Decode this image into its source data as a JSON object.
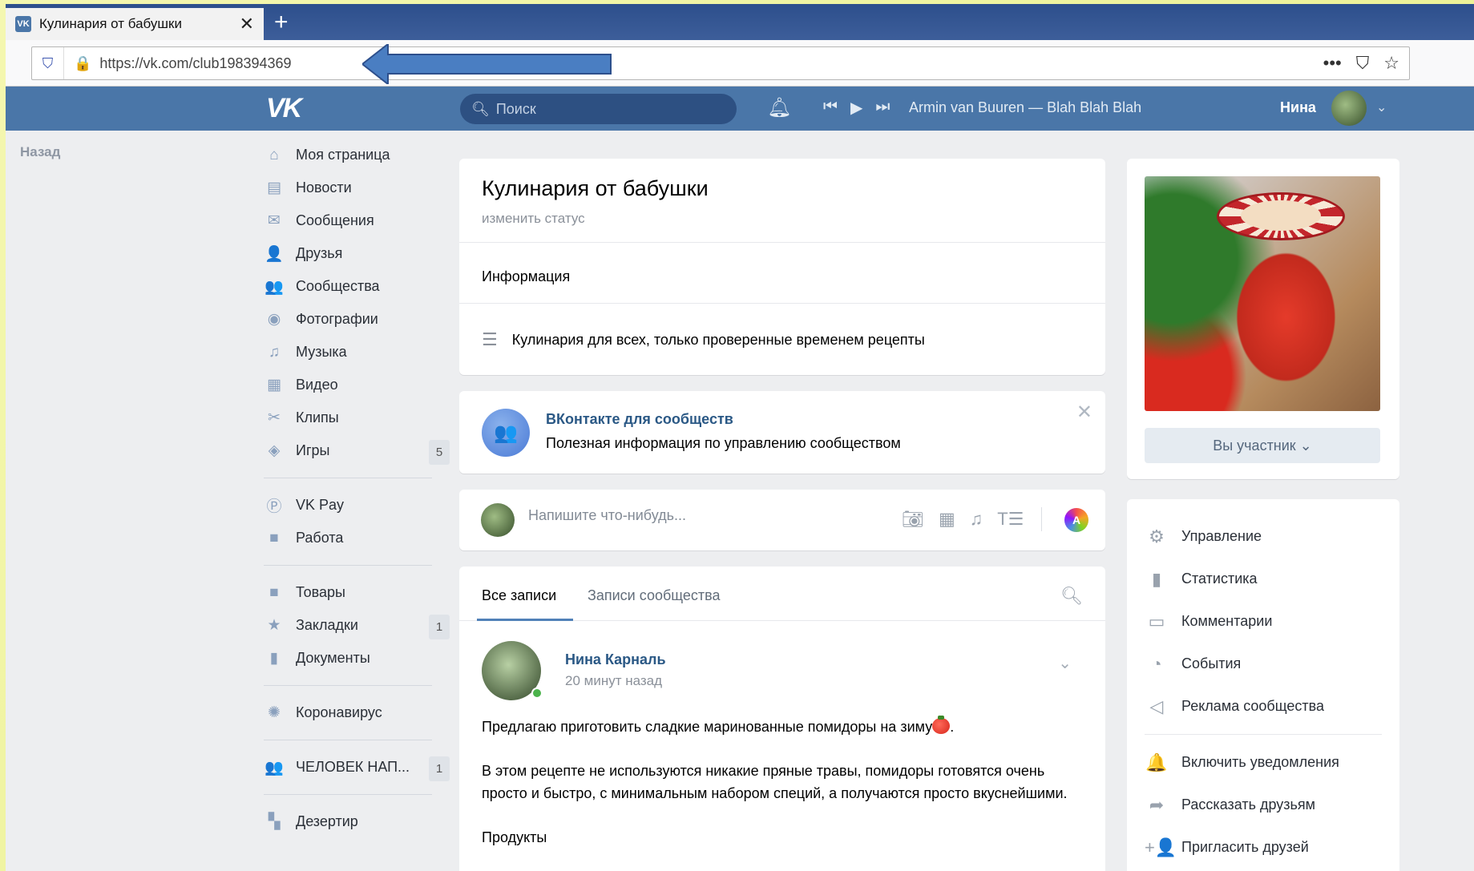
{
  "browser": {
    "tab_title": "Кулинария от бабушки",
    "tab_favicon": "VK",
    "new_tab": "+",
    "close": "✕",
    "url": "https://vk.com/club198394369",
    "menu": "•••"
  },
  "header": {
    "logo": "VK",
    "search_placeholder": "Поиск",
    "track": "Armin van Buuren — Blah Blah Blah",
    "user_name": "Нина"
  },
  "back": "Назад",
  "left_nav": {
    "group1": [
      {
        "label": "Моя страница",
        "icon": "home-icon",
        "glyph": "⌂"
      },
      {
        "label": "Новости",
        "icon": "news-icon",
        "glyph": "▤"
      },
      {
        "label": "Сообщения",
        "icon": "messages-icon",
        "glyph": "✉"
      },
      {
        "label": "Друзья",
        "icon": "friends-icon",
        "glyph": "👤"
      },
      {
        "label": "Сообщества",
        "icon": "communities-icon",
        "glyph": "👥"
      },
      {
        "label": "Фотографии",
        "icon": "camera-icon",
        "glyph": "◉"
      },
      {
        "label": "Музыка",
        "icon": "music-icon",
        "glyph": "♫"
      },
      {
        "label": "Видео",
        "icon": "video-icon",
        "glyph": "▦"
      },
      {
        "label": "Клипы",
        "icon": "clips-icon",
        "glyph": "✂"
      },
      {
        "label": "Игры",
        "icon": "games-icon",
        "glyph": "◈",
        "badge": "5"
      }
    ],
    "group2": [
      {
        "label": "VK Pay",
        "icon": "vkpay-icon",
        "glyph": "Ⓟ"
      },
      {
        "label": "Работа",
        "icon": "work-icon",
        "glyph": "■"
      }
    ],
    "group3": [
      {
        "label": "Товары",
        "icon": "goods-icon",
        "glyph": "■"
      },
      {
        "label": "Закладки",
        "icon": "star-icon",
        "glyph": "★",
        "badge": "1"
      },
      {
        "label": "Документы",
        "icon": "document-icon",
        "glyph": "▮"
      }
    ],
    "group4": [
      {
        "label": "Коронавирус",
        "icon": "virus-icon",
        "glyph": "✺"
      }
    ],
    "group5": [
      {
        "label": "ЧЕЛОВЕК НАП...",
        "icon": "group-icon",
        "glyph": "👥",
        "badge": "1"
      }
    ],
    "group6": [
      {
        "label": "Дезертир",
        "icon": "apps-icon",
        "glyph": "▚"
      }
    ]
  },
  "group": {
    "title": "Кулинария от бабушки",
    "status": "изменить статус",
    "info_title": "Информация",
    "description": "Кулинария для всех, только проверенные временем рецепты"
  },
  "promo": {
    "title": "ВКонтакте для сообществ",
    "text": "Полезная информация по управлению сообществом"
  },
  "compose": {
    "placeholder": "Напишите что-нибудь...",
    "color_label": "A"
  },
  "feed": {
    "tab_all": "Все записи",
    "tab_community": "Записи сообщества",
    "post": {
      "author": "Нина Карналь",
      "time": "20 минут назад",
      "p1": "Предлагаю приготовить сладкие маринованные помидоры на зиму",
      "p1_end": ".",
      "p2": "В этом рецепте не используются никакие пряные травы, помидоры готовятся очень просто и быстро, с минимальным набором специй, а получаются просто вкуснейшими.",
      "p3": "Продукты"
    }
  },
  "sidebar": {
    "member_button": "Вы участник ⌄",
    "menu": [
      {
        "label": "Управление",
        "icon": "gear-icon",
        "glyph": "⚙"
      },
      {
        "label": "Статистика",
        "icon": "stats-icon",
        "glyph": "▮"
      },
      {
        "label": "Комментарии",
        "icon": "comment-icon",
        "glyph": "▭"
      },
      {
        "label": "События",
        "icon": "events-icon",
        "glyph": "◔"
      },
      {
        "label": "Реклама сообщества",
        "icon": "megaphone-icon",
        "glyph": "◁"
      }
    ],
    "menu2": [
      {
        "label": "Включить уведомления",
        "icon": "bell-icon",
        "glyph": "🔔"
      },
      {
        "label": "Рассказать друзьям",
        "icon": "share-icon",
        "glyph": "➦"
      },
      {
        "label": "Пригласить друзей",
        "icon": "invite-icon",
        "glyph": "+👤"
      }
    ]
  },
  "colors": {
    "vk_blue": "#4a76a8",
    "link": "#2a5885",
    "annotation_arrow": "#4a7ec2"
  }
}
